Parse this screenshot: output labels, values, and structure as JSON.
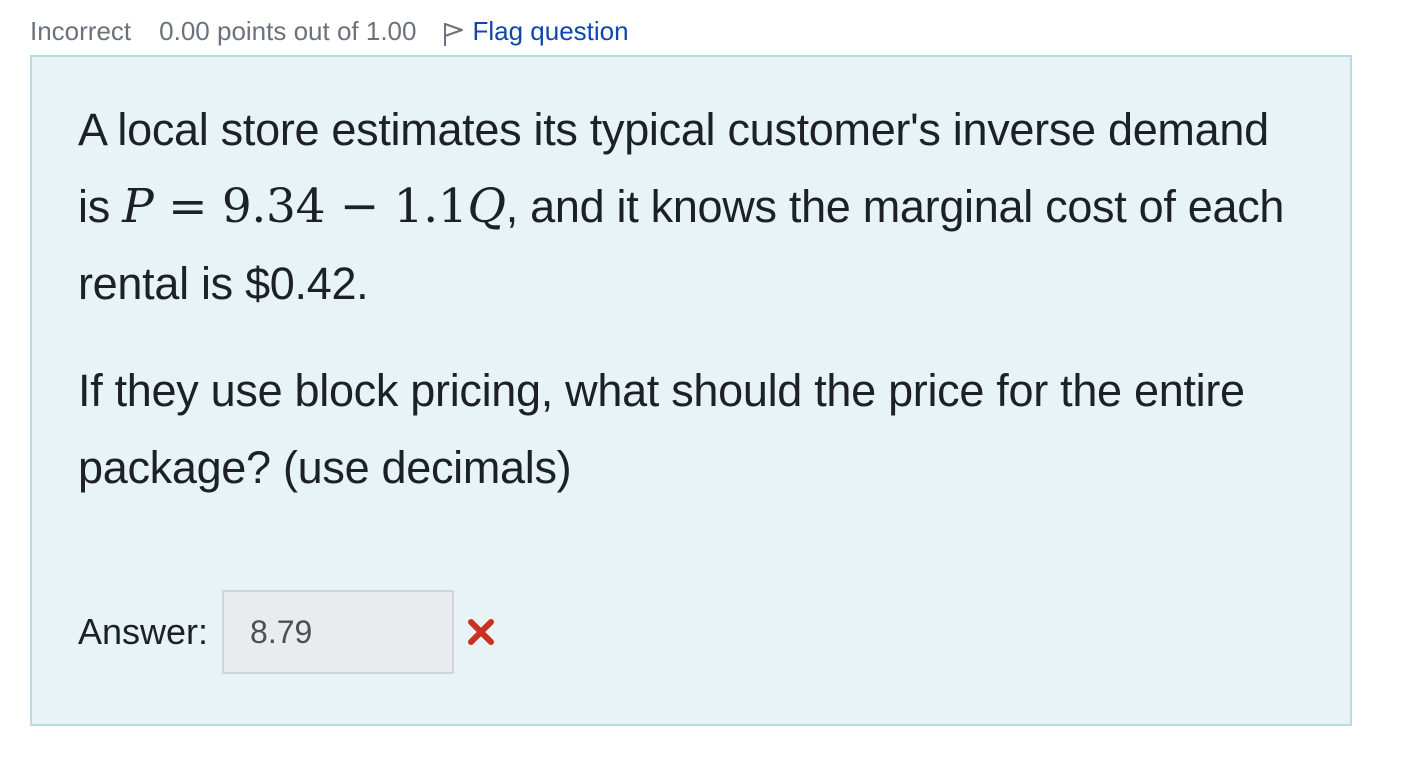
{
  "info": {
    "state": "Incorrect",
    "grade": "0.00 points out of 1.00",
    "flag_label": "Flag question",
    "flag_icon": "flag-outline-icon"
  },
  "question": {
    "para1_before": "A local store estimates its typical customer's inverse demand is",
    "equation": {
      "lhs": "P",
      "eq": "=",
      "constant": "9.34",
      "minus": "−",
      "coef": "1.1",
      "var": "Q"
    },
    "para1_after": ", and it knows the marginal cost of each rental is $0.42.",
    "para2": "If they use block pricing, what should the price for the entire package? (use decimals)"
  },
  "answer": {
    "label": "Answer:",
    "value": "8.79",
    "status_icon": "incorrect-x-icon",
    "status_color": "#ca3120"
  },
  "colors": {
    "box_bg": "#e7f3f5",
    "box_border": "#b8dce2",
    "link": "#0f47ad",
    "muted": "#6a737b"
  }
}
